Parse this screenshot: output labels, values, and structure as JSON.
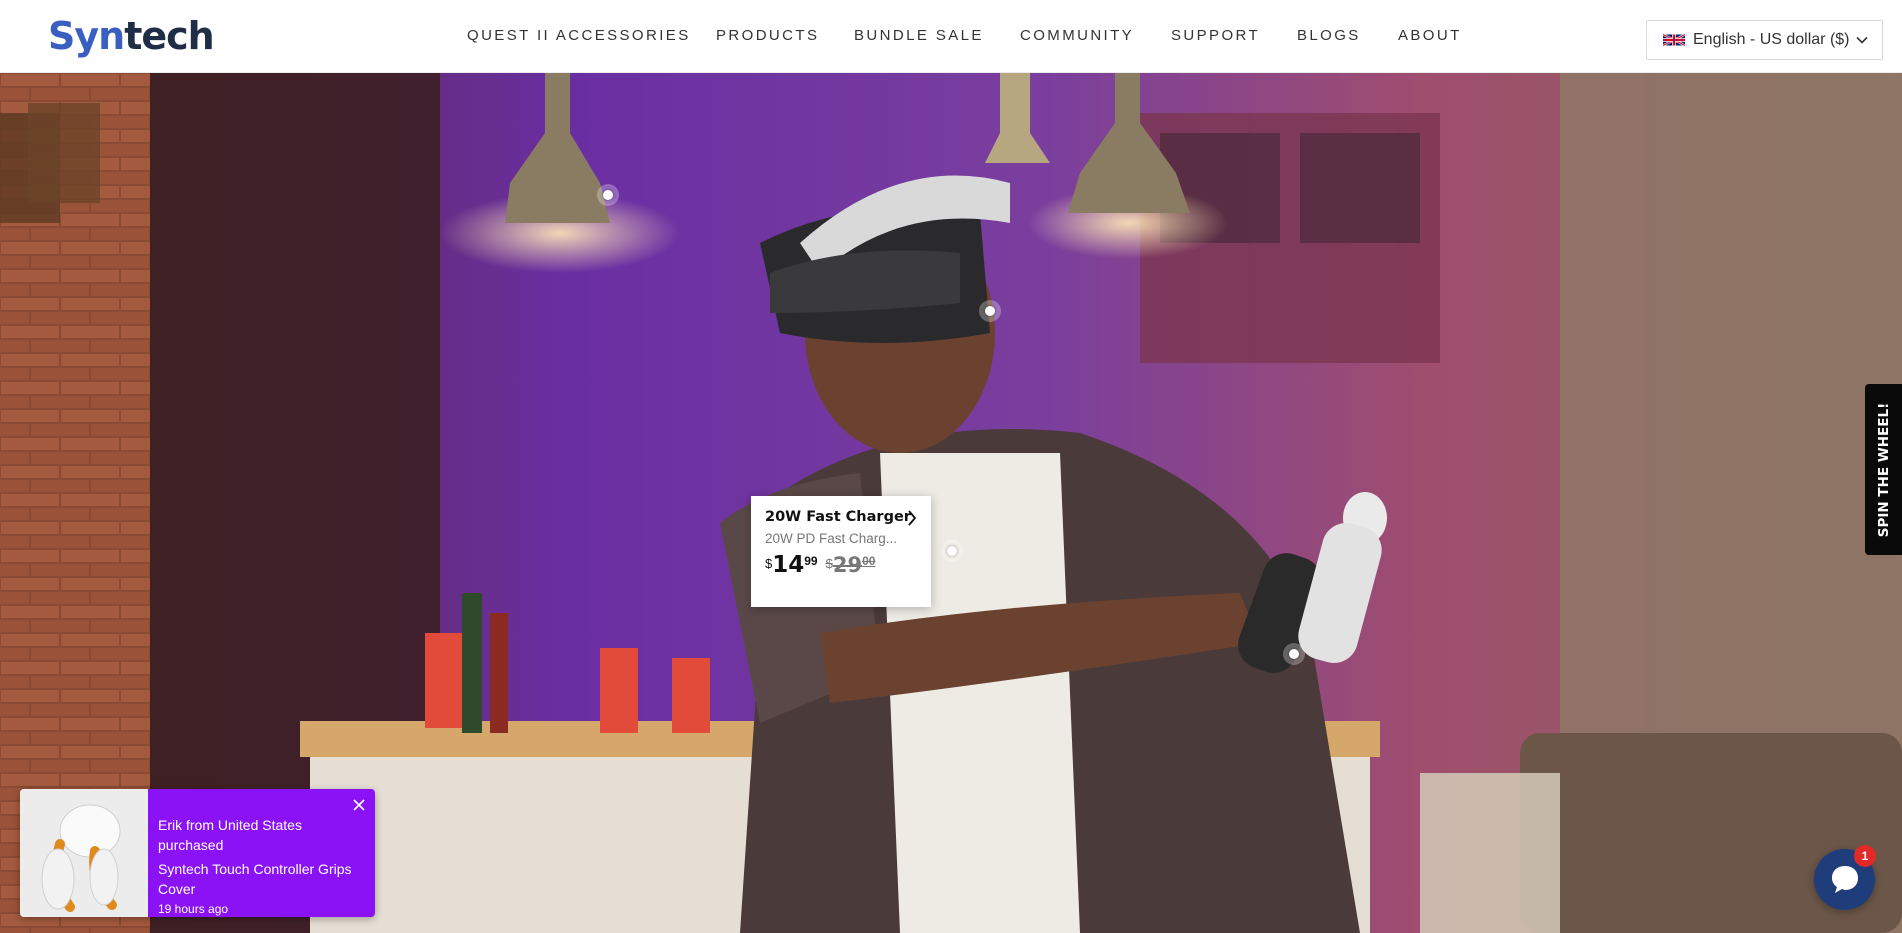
{
  "header": {
    "logo": {
      "part1": "Syn",
      "part2": "tech"
    },
    "nav": [
      {
        "label": "QUEST II ACCESSORIES"
      },
      {
        "label": "PRODUCTS"
      },
      {
        "label": "BUNDLE SALE"
      },
      {
        "label": "COMMUNITY"
      },
      {
        "label": "SUPPORT"
      },
      {
        "label": "BLOGS"
      },
      {
        "label": "ABOUT"
      }
    ],
    "language_selector": {
      "label": "English - US dollar ($)",
      "flag_icon": "uk-flag-icon"
    }
  },
  "hero": {
    "product_popup": {
      "title": "20W Fast Charger",
      "subtitle": "20W PD Fast Charg...",
      "price": {
        "currency": "$",
        "whole": "14",
        "cents": "99"
      },
      "compare_price": {
        "currency": "$",
        "whole": "29",
        "cents": "00"
      }
    }
  },
  "spin_tab": {
    "label": "SPIN THE WHEEL!"
  },
  "notification": {
    "line1": "Erik from United States purchased",
    "product": "Syntech Touch Controller Grips Cover",
    "time": "19 hours ago"
  },
  "chat": {
    "badge": "1"
  },
  "colors": {
    "logo_blue": "#3a5fc0",
    "logo_dark": "#1f2d47",
    "notification_purple": "#8a12f5",
    "chat_blue": "#1e3d7a",
    "badge_red": "#e32828"
  }
}
